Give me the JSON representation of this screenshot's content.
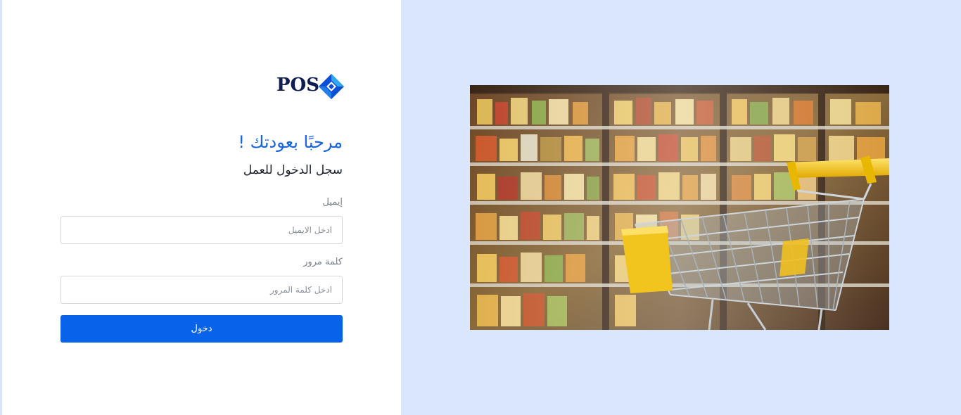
{
  "brand": {
    "logo_text": "POS",
    "logo_mark_icon": "diamond-logo-icon",
    "colors": {
      "navy": "#0f1d52",
      "blue": "#1664e0",
      "cyan": "#2fa8f0"
    }
  },
  "login": {
    "title": "مرحبًا بعودتك !",
    "subtitle": "سجل الدخول للعمل",
    "email_label": "إيميل",
    "email_placeholder": "ادخل الايميل",
    "email_value": "",
    "password_label": "كلمة مرور",
    "password_placeholder": "ادخل كلمة المرور",
    "password_value": "",
    "submit_label": "دخول"
  },
  "illustration": {
    "subject": "shopping-cart-in-supermarket-aisle",
    "background_color": "#d9e6fb"
  },
  "colors": {
    "primary_button": "#0962ea",
    "title": "#1664e0",
    "panel_background": "#ffffff",
    "page_background": "#d9e6fb"
  }
}
